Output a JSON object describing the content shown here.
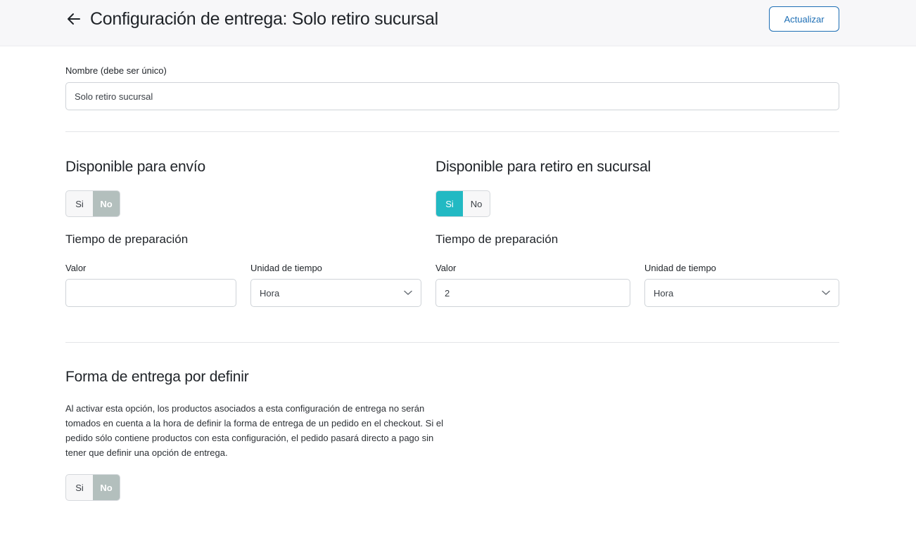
{
  "header": {
    "title": "Configuración de entrega: Solo retiro sucursal",
    "update_label": "Actualizar"
  },
  "name_field": {
    "label": "Nombre (debe ser único)",
    "value": "Solo retiro sucursal"
  },
  "shipping": {
    "title": "Disponible para envío",
    "toggle": {
      "yes": "Si",
      "no": "No",
      "selected": "No"
    },
    "prep_title": "Tiempo de preparación",
    "value_label": "Valor",
    "value": "",
    "unit_label": "Unidad de tiempo",
    "unit": "Hora"
  },
  "pickup": {
    "title": "Disponible para retiro en sucursal",
    "toggle": {
      "yes": "Si",
      "no": "No",
      "selected": "Si"
    },
    "prep_title": "Tiempo de preparación",
    "value_label": "Valor",
    "value": "2",
    "unit_label": "Unidad de tiempo",
    "unit": "Hora"
  },
  "undefined_delivery": {
    "title": "Forma de entrega por definir",
    "description": "Al activar esta opción, los productos asociados a esta configuración de entrega no serán tomados en cuenta a la hora de definir la forma de entrega de un pedido en el checkout. Si el pedido sólo contiene productos con esta configuración, el pedido pasará directo a pago sin tener que definir una opción de entrega.",
    "toggle": {
      "yes": "Si",
      "no": "No",
      "selected": "No"
    }
  },
  "colors": {
    "accent_blue": "#1e6fb5",
    "toggle_teal": "#22b9c3",
    "toggle_grey": "#b3bfbd"
  },
  "icons": {
    "back": "arrow-left-icon",
    "select": "chevron-down-icon"
  }
}
